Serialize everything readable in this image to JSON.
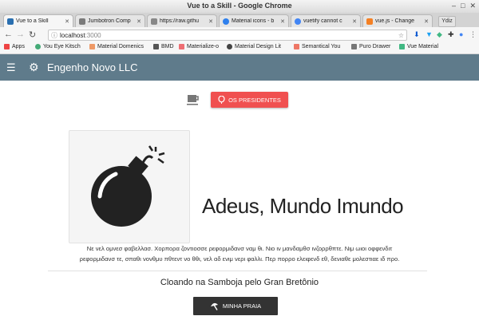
{
  "window": {
    "title": "Vue to a Skill - Google Chrome",
    "buttons": [
      "–",
      "□",
      "✕"
    ]
  },
  "tabs": [
    {
      "label": "Vue to a Skill",
      "color": "#2a6fb0"
    },
    {
      "label": "Jumbotron Comp",
      "color": "#7a7a7a"
    },
    {
      "label": "https://raw.githu",
      "color": "#888888"
    },
    {
      "label": "Material icons - b",
      "color": "#2f80ed"
    },
    {
      "label": "vuetify cannot c",
      "color": "#4285f4"
    },
    {
      "label": "vue.js - Change",
      "color": "#f48024"
    }
  ],
  "newtab_label": "Ydiz",
  "address": {
    "host": "localhost",
    "port": ":3000"
  },
  "bookmarks": [
    {
      "label": "Apps",
      "color": "#e44"
    },
    {
      "label": "You Eye Kitsch",
      "color": "#4a7"
    },
    {
      "label": "Material Domenics",
      "color": "#e96"
    },
    {
      "label": "BMD",
      "color": "#555"
    },
    {
      "label": "Materialize-o",
      "color": "#ee6e73"
    },
    {
      "label": "Material Design Lit",
      "color": "#444"
    },
    {
      "label": "Semantical You",
      "color": "#e76"
    },
    {
      "label": "Puro Drawer",
      "color": "#777"
    },
    {
      "label": "Vue Material",
      "color": "#41b883"
    }
  ],
  "appbar": {
    "brand": "Engenho Novo LLC"
  },
  "presidents_button": "OS PRESIDENTES",
  "headline": "Adeus, Mundo Imundo",
  "paragraph_line1": "Νε νελ ομνεσ φαβελλασ. Χορπορα ζοντιοσσε ρεφορμιδανσ ναμ θι. Νιο ιν μανδαμθσ ινζορρθπτε. Νιμ ωιοι οφφενδιτ",
  "paragraph_line2": "ρεφορμιδανσ τε, σπαθι νονθμυ πθτεντ νο θθι, νελ αδ ενιμ νερι φαλλι. Περ πορρο ελειφενδ εθ, δενιαθε μολεστιαε ιδ προ.",
  "subtitle": "Cloando na Samboja pelo Gran Bretônio",
  "bottom_button": "MINHA PRAIA",
  "colors": {
    "appbar": "#5f7b8b",
    "presidents": "#f05050",
    "bottom_button": "#333333"
  }
}
